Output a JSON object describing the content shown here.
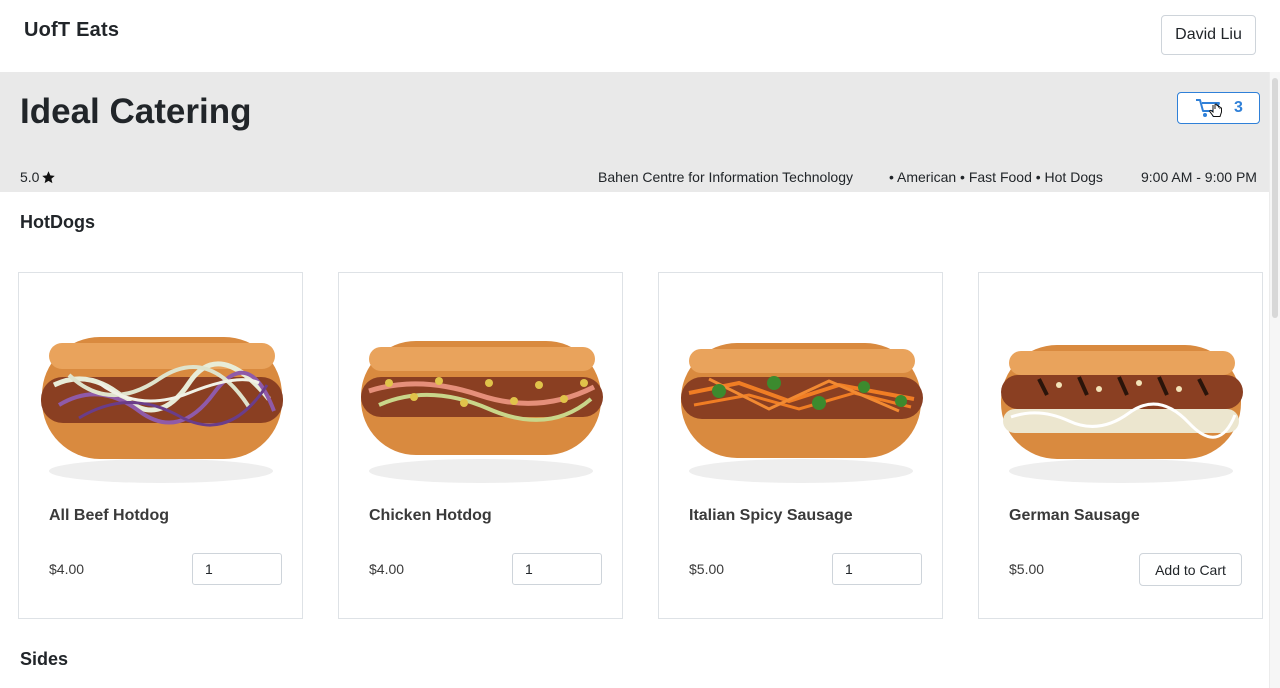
{
  "app": {
    "brand": "UofT Eats",
    "user": "David Liu"
  },
  "restaurant": {
    "name": "Ideal Catering",
    "rating": "5.0",
    "location": "Bahen Centre for Information Technology",
    "cuisines": "• American • Fast Food • Hot Dogs",
    "hours": "9:00 AM - 9:00 PM",
    "cart_count": "3"
  },
  "sections": {
    "hotdogs": "HotDogs",
    "sides": "Sides"
  },
  "menu": [
    {
      "name": "All Beef Hotdog",
      "price": "$4.00",
      "quantity": "1",
      "topping": "slaw"
    },
    {
      "name": "Chicken Hotdog",
      "price": "$4.00",
      "quantity": "1",
      "topping": "relish"
    },
    {
      "name": "Italian Spicy Sausage",
      "price": "$5.00",
      "quantity": "1",
      "topping": "carrot-cilantro"
    },
    {
      "name": "German Sausage",
      "price": "$5.00",
      "add_label": "Add to Cart",
      "topping": "sauerkraut"
    }
  ],
  "colors": {
    "accent": "#2f80d8",
    "hero_bg": "#e9e9e9",
    "bun": "#d98a3f"
  },
  "icons": {
    "cart": "cart-icon",
    "star": "star-icon",
    "cursor": "hand-cursor-icon"
  }
}
